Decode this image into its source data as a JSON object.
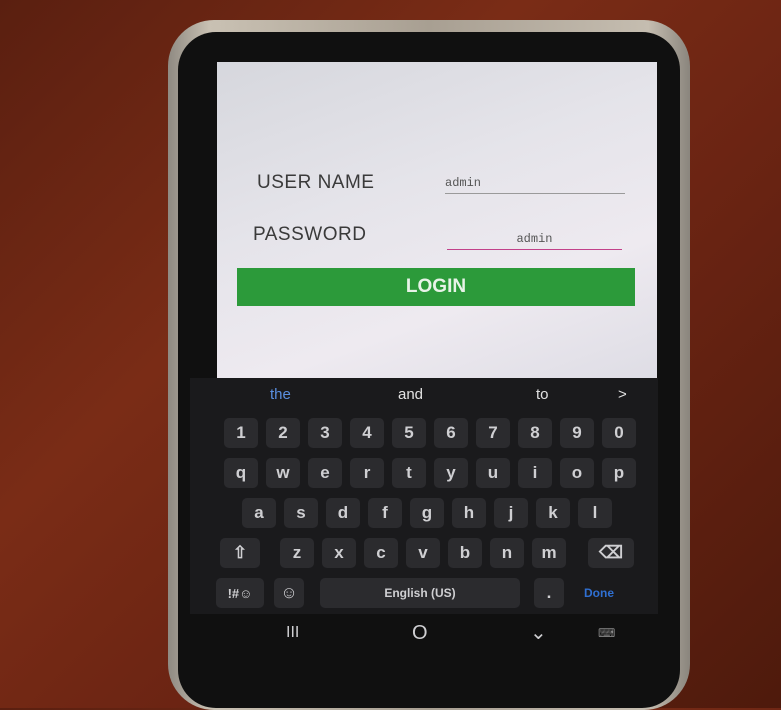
{
  "form": {
    "username_label": "USER NAME",
    "username_value": "admin",
    "password_label": "PASSWORD",
    "password_value": "admin",
    "login_label": "LOGIN"
  },
  "keyboard": {
    "suggestions": [
      "the",
      "and",
      "to",
      ">"
    ],
    "number_row": [
      "1",
      "2",
      "3",
      "4",
      "5",
      "6",
      "7",
      "8",
      "9",
      "0"
    ],
    "row1": [
      "q",
      "w",
      "e",
      "r",
      "t",
      "y",
      "u",
      "i",
      "o",
      "p"
    ],
    "row2": [
      "a",
      "s",
      "d",
      "f",
      "g",
      "h",
      "j",
      "k",
      "l"
    ],
    "row3": [
      "z",
      "x",
      "c",
      "v",
      "b",
      "n",
      "m"
    ],
    "symbols_key": "!#☺",
    "space_label": "English (US)",
    "period_key": ".",
    "done_label": "Done"
  },
  "nav": {
    "recents": "III",
    "home": "O",
    "back": "⌄"
  },
  "colors": {
    "login_button": "#2c9a3a",
    "keyboard_bg": "#1a1a1c",
    "suggestion_highlight": "#5a8fe0",
    "done": "#2f6fd1"
  }
}
